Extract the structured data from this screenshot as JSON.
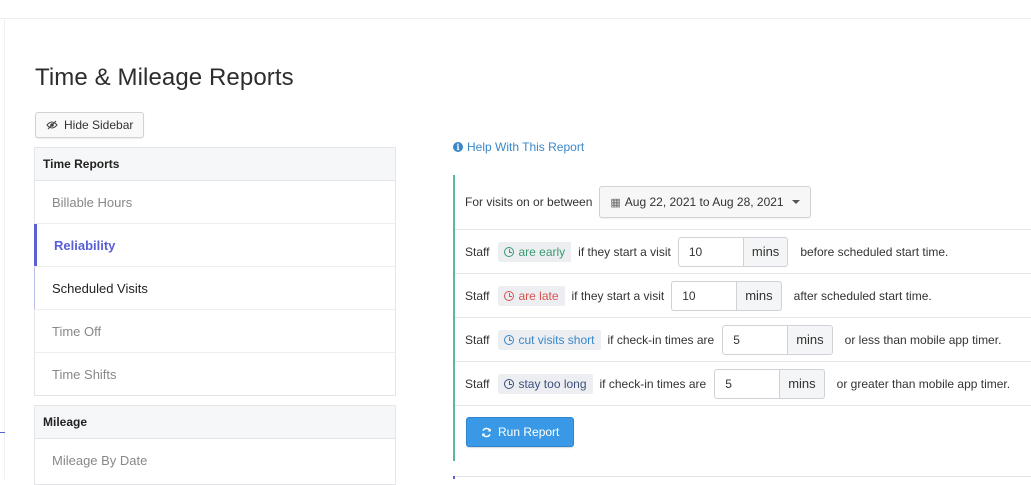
{
  "page": {
    "title": "Time & Mileage Reports"
  },
  "toolbar": {
    "hide_sidebar_label": "Hide Sidebar"
  },
  "sidebar": {
    "time_reports": {
      "header": "Time Reports",
      "items": [
        {
          "label": "Billable Hours",
          "state": "normal"
        },
        {
          "label": "Reliability",
          "state": "active"
        },
        {
          "label": "Scheduled Visits",
          "state": "hover"
        },
        {
          "label": "Time Off",
          "state": "normal"
        },
        {
          "label": "Time Shifts",
          "state": "normal"
        }
      ]
    },
    "mileage": {
      "header": "Mileage",
      "items": [
        {
          "label": "Mileage By Date",
          "state": "normal"
        }
      ]
    }
  },
  "help": {
    "label": "Help With This Report",
    "icon": "info-icon"
  },
  "report": {
    "date_row": {
      "label": "For visits on or between",
      "range": "Aug 22, 2021 to Aug 28, 2021",
      "icon": "calendar-icon"
    },
    "rules": [
      {
        "staff": "Staff",
        "badge": "are early",
        "badge_color": "#3a9a73",
        "condition": "if they start a visit",
        "value": "10",
        "unit": "mins",
        "suffix": "before scheduled start time."
      },
      {
        "staff": "Staff",
        "badge": "are late",
        "badge_color": "#d9534f",
        "condition": "if they start a visit",
        "value": "10",
        "unit": "mins",
        "suffix": "after scheduled start time."
      },
      {
        "staff": "Staff",
        "badge": "cut visits short",
        "badge_color": "#3a87c9",
        "condition": "if check-in times are",
        "value": "5",
        "unit": "mins",
        "suffix": "or less than mobile app timer."
      },
      {
        "staff": "Staff",
        "badge": "stay too long",
        "badge_color": "#3d4f7c",
        "condition": "if check-in times are",
        "value": "5",
        "unit": "mins",
        "suffix": "or greater than mobile app timer."
      }
    ],
    "run_label": "Run Report"
  },
  "colors": {
    "accent": "#5a5fd8",
    "report_border": "#59bb9a",
    "primary_button": "#3a99e6",
    "link": "#3a87c9"
  }
}
